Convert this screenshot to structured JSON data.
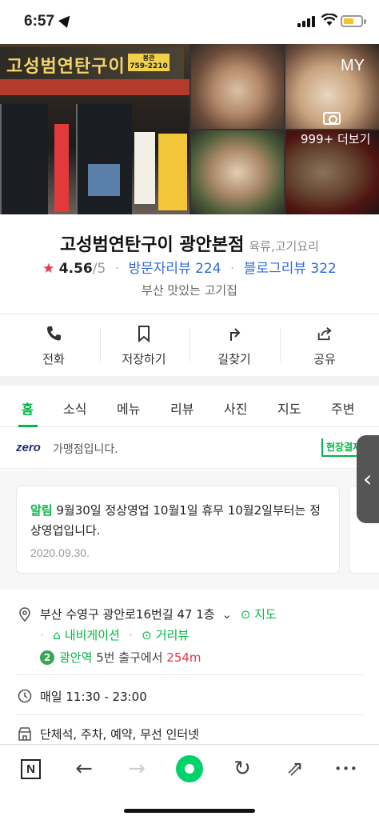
{
  "status_bar": {
    "time": "6:57"
  },
  "photos": {
    "storefront_sign": "고성범연탄구이",
    "storefront_phone": "759-2210",
    "my_label": "MY",
    "more_label": "999+ 더보기"
  },
  "place": {
    "name": "고성범연탄구이 광안본점",
    "category": "육류,고기요리",
    "rating": "4.56",
    "rating_max": "/5",
    "visitor_reviews": "방문자리뷰 224",
    "blog_reviews": "블로그리뷰 322",
    "description": "부산 맛있는 고기집"
  },
  "actions": [
    {
      "label": "전화",
      "icon": "phone-icon"
    },
    {
      "label": "저장하기",
      "icon": "bookmark-icon"
    },
    {
      "label": "길찾기",
      "icon": "directions-icon"
    },
    {
      "label": "공유",
      "icon": "share-icon"
    }
  ],
  "tabs": [
    {
      "label": "홈",
      "active": true
    },
    {
      "label": "소식"
    },
    {
      "label": "메뉴"
    },
    {
      "label": "리뷰"
    },
    {
      "label": "사진"
    },
    {
      "label": "지도"
    },
    {
      "label": "주변"
    }
  ],
  "zero_pay": {
    "logo": "zero",
    "text": "가맹점입니다.",
    "badge": "현장결제"
  },
  "notice": {
    "tag": "알림",
    "text": "9월30일 정상영업 10월1일 휴무 10월2일부터는 정상영업입니다.",
    "date": "2020.09.30."
  },
  "info": {
    "address": "부산 수영구 광안로16번길 47 1층",
    "map_link": "지도",
    "navigation_link": "내비게이션",
    "distance_link": "거리뷰",
    "subway_line": "2",
    "subway_station": "광안역",
    "subway_exit": "5번 출구에서",
    "subway_distance": "254m",
    "hours": "매일 11:30 - 23:00",
    "facilities": "단체석, 주차, 예약, 무선 인터넷"
  },
  "toolbar": {
    "naver": "N",
    "back": "←",
    "forward": "→",
    "refresh": "↻",
    "share": "⇗",
    "more": "•••"
  },
  "colors": {
    "accent_green": "#00b843",
    "star_red": "#e8364d",
    "link_blue": "#2d6bd6"
  }
}
